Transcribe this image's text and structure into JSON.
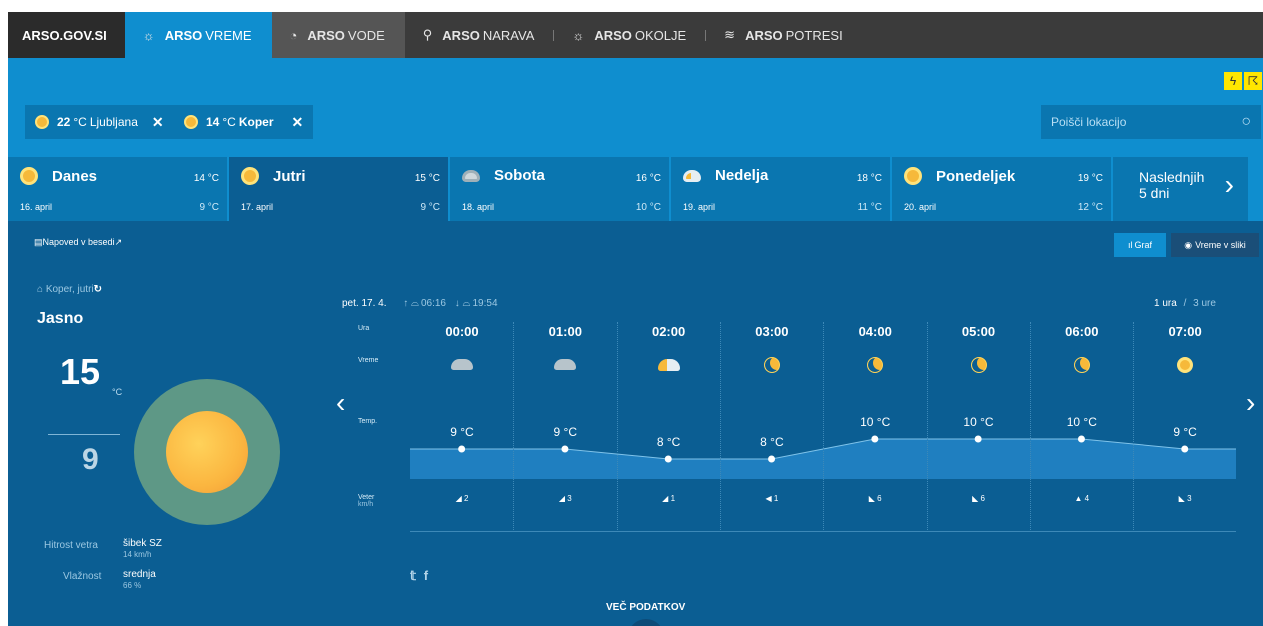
{
  "nav": {
    "home": "ARSO.GOV.SI",
    "items": [
      {
        "bold": "ARSO",
        "rest": "VREME",
        "icon": "☼"
      },
      {
        "bold": "ARSO",
        "rest": "VODE",
        "icon": "◔"
      },
      {
        "bold": "ARSO",
        "rest": "NARAVA",
        "icon": "⚲"
      },
      {
        "bold": "ARSO",
        "rest": "OKOLJE",
        "icon": "☼"
      },
      {
        "bold": "ARSO",
        "rest": "POTRESI",
        "icon": "≋"
      }
    ]
  },
  "warnings": [
    "lightning-warning-icon",
    "thunder-warning-icon"
  ],
  "chips": [
    {
      "temp": "22",
      "unit": "°C",
      "city": "Ljubljana",
      "close": "✕"
    },
    {
      "temp": "14",
      "unit": "°C",
      "city": "Koper",
      "close": "✕"
    }
  ],
  "search": {
    "placeholder": "Poišči lokacijo"
  },
  "days": [
    {
      "name": "Danes",
      "date": "16. april",
      "max": "14 °C",
      "min": "9 °C",
      "icon": "sun"
    },
    {
      "name": "Jutri",
      "date": "17. april",
      "max": "15 °C",
      "min": "9 °C",
      "icon": "sun"
    },
    {
      "name": "Sobota",
      "date": "18. april",
      "max": "16 °C",
      "min": "10 °C",
      "icon": "cloud"
    },
    {
      "name": "Nedelja",
      "date": "19. april",
      "max": "18 °C",
      "min": "11 °C",
      "icon": "suncloud"
    },
    {
      "name": "Ponedeljek",
      "date": "20. april",
      "max": "19 °C",
      "min": "12 °C",
      "icon": "sun"
    }
  ],
  "next5": {
    "line1": "Naslednjih",
    "line2": "5 dni"
  },
  "napoved": "Napoved v besedi",
  "buttons": {
    "graf": "Graf",
    "slika": "Vreme v sliki"
  },
  "current": {
    "location": "Koper, jutri",
    "condition": "Jasno",
    "max": "15",
    "unit": "°C",
    "min": "9",
    "wind_label": "Hitrost vetra",
    "wind_value": "šibek SZ",
    "wind_speed": "14 km/h",
    "humidity_label": "Vlažnost",
    "humidity_value": "srednja",
    "humidity_pct": "66 %"
  },
  "hourly": {
    "date": "pet. 17. 4.",
    "sunrise": "06:16",
    "sunset": "19:54",
    "switch_active": "1 ura",
    "switch_sep": "/",
    "switch_other": "3 ure",
    "labels": {
      "ura": "Ura",
      "vreme": "Vreme",
      "temp": "Temp.",
      "veter": "Veter",
      "veter_unit": "km/h"
    },
    "hours": [
      {
        "time": "00:00",
        "icon": "cloud",
        "temp": "9 °C",
        "t": 9,
        "wind": "2",
        "dir": "◢"
      },
      {
        "time": "01:00",
        "icon": "cloud",
        "temp": "9 °C",
        "t": 9,
        "wind": "3",
        "dir": "◢"
      },
      {
        "time": "02:00",
        "icon": "suncloud",
        "temp": "8 °C",
        "t": 8,
        "wind": "1",
        "dir": "◢"
      },
      {
        "time": "03:00",
        "icon": "moon",
        "temp": "8 °C",
        "t": 8,
        "wind": "1",
        "dir": "◀"
      },
      {
        "time": "04:00",
        "icon": "moon",
        "temp": "10 °C",
        "t": 10,
        "wind": "6",
        "dir": "◣"
      },
      {
        "time": "05:00",
        "icon": "moon",
        "temp": "10 °C",
        "t": 10,
        "wind": "6",
        "dir": "◣"
      },
      {
        "time": "06:00",
        "icon": "moon",
        "temp": "10 °C",
        "t": 10,
        "wind": "4",
        "dir": "▲"
      },
      {
        "time": "07:00",
        "icon": "sun",
        "temp": "9 °C",
        "t": 9,
        "wind": "3",
        "dir": "◣"
      }
    ]
  },
  "social": {
    "twitter": "𝕥",
    "facebook": "f"
  },
  "more": "VEČ PODATKOV",
  "more_icon": "chevron-down-icon"
}
